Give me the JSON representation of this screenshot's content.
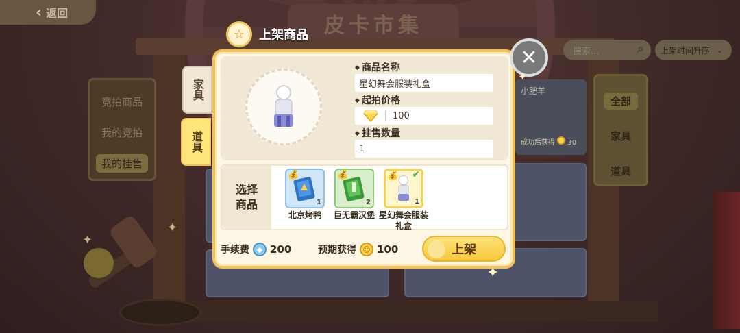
{
  "background": {
    "back_label": "返回",
    "banner_title": "皮卡市集",
    "left_tabs": [
      "竞拍商品",
      "我的竞拍",
      "我的挂售"
    ],
    "left_active": "我的挂售",
    "right_tabs": [
      "全部",
      "家具",
      "道具"
    ],
    "right_active": "全部",
    "search_placeholder": "搜索...",
    "sort_label": "上架时间升序",
    "card_name": "小肥羊",
    "card_sub": "成功后获得",
    "card_reward": "30"
  },
  "dialog": {
    "title": "上架商品",
    "close_icon": "close-icon",
    "side_tabs": [
      {
        "label": "家具",
        "active": false
      },
      {
        "label": "道具",
        "active": true
      }
    ],
    "fields": {
      "name_label": "商品名称",
      "name_value": "星幻舞会服装礼盒",
      "price_label": "起拍价格",
      "price_value": "100",
      "qty_label": "挂售数量",
      "qty_value": "1"
    },
    "select_label": "选择商品",
    "items": [
      {
        "name": "北京烤鸭",
        "qty": "1",
        "icon": "roast-duck-card-icon",
        "color": "blue",
        "selected": false
      },
      {
        "name": "巨无霸汉堡",
        "qty": "2",
        "icon": "burger-card-icon",
        "color": "green",
        "selected": false
      },
      {
        "name": "星幻舞会服装礼盒",
        "qty": "1",
        "icon": "costume-giftbox-icon",
        "color": "yellow",
        "selected": true
      }
    ],
    "fee_label": "手续费",
    "fee_value": "200",
    "earn_label": "预期获得",
    "earn_value": "100",
    "submit_label": "上架"
  },
  "colors": {
    "dialog_border": "#f2c25a",
    "accent_yellow": "#ffe27a",
    "panel_bg": "#f2e8d6"
  }
}
